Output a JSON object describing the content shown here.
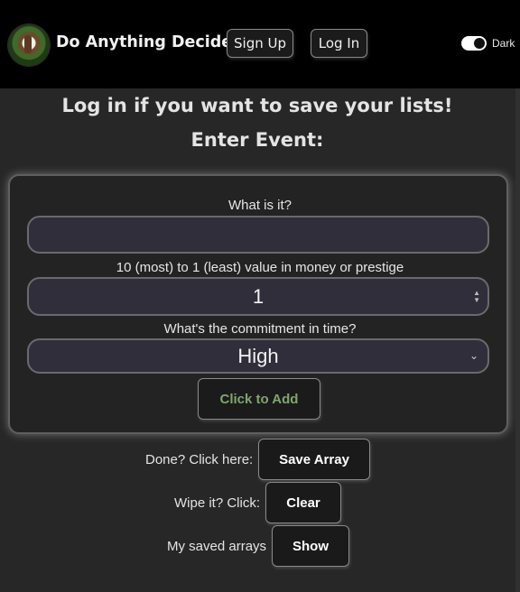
{
  "header": {
    "app_title": "Do Anything Decider",
    "signup_label": "Sign Up",
    "login_label": "Log In",
    "theme_toggle_label": "Dark",
    "theme_toggle_on": true
  },
  "main": {
    "heading_login": "Log in if you want to save your lists!",
    "heading_event": "Enter Event:"
  },
  "form": {
    "what_label": "What is it?",
    "what_value": "",
    "value_label": "10 (most) to 1 (least) value in money or prestige",
    "value_value": "1",
    "commitment_label": "What's the commitment in time?",
    "commitment_value": "High",
    "add_button_label": "Click to Add"
  },
  "actions": {
    "save_prompt": "Done? Click here:",
    "save_button": "Save Array",
    "clear_prompt": "Wipe it? Click:",
    "clear_button": "Clear",
    "show_prompt": "My saved arrays",
    "show_button": "Show"
  },
  "colors": {
    "header_bg": "#000000",
    "page_bg": "#272727",
    "field_bg": "#2f2e3a",
    "add_button_text": "#7fa66c"
  },
  "icons": {
    "logo": "dog-avatar-icon",
    "spinner": "number-spinner-icon",
    "select_arrow": "chevron-down-icon"
  }
}
